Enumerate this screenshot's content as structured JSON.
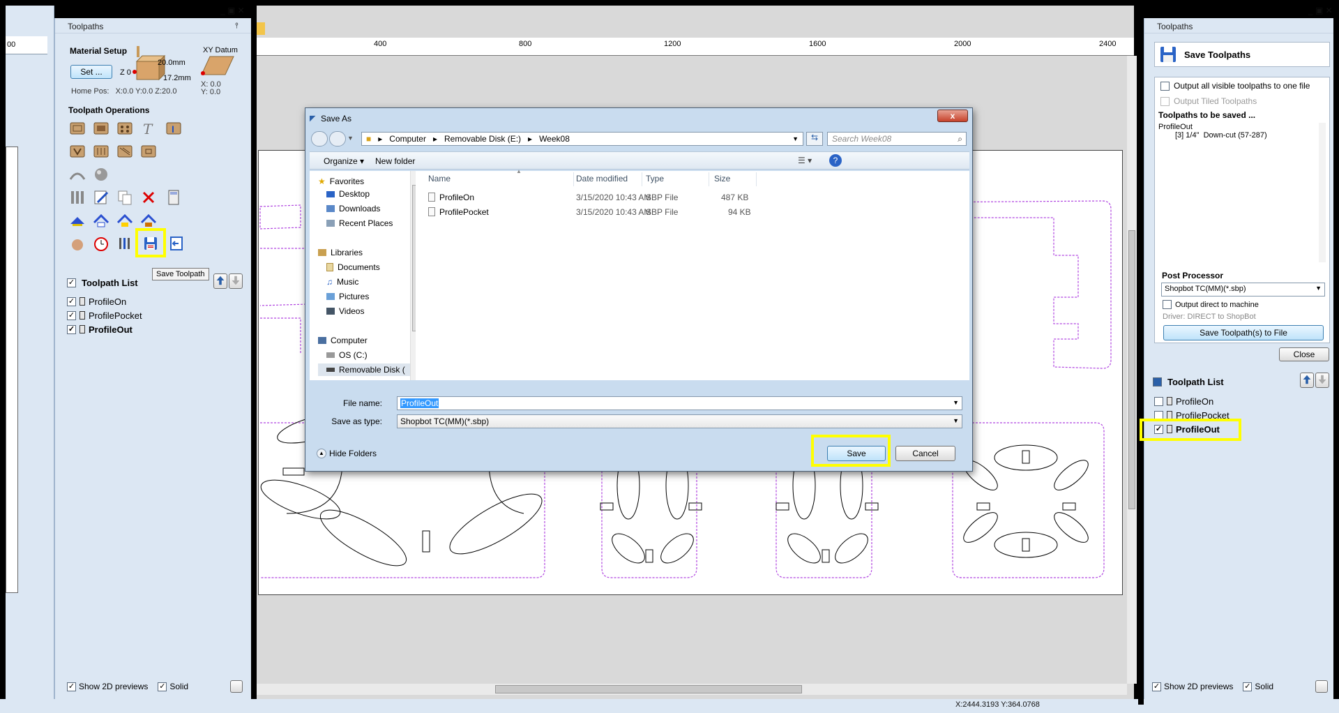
{
  "left_panel": {
    "title": "Toolpaths",
    "material_setup": {
      "heading": "Material Setup",
      "set_button": "Set ...",
      "dim_top": "20.0mm",
      "dim_bottom": "17.2mm",
      "z0": "Z 0",
      "xy_datum_label": "XY Datum",
      "home_pos": "Home Pos:   X:0.0 Y:0.0 Z:20.0",
      "datum_x": "X: 0.0",
      "datum_y": "Y: 0.0"
    },
    "operations_heading": "Toolpath Operations",
    "tooltip": "Save Toolpath",
    "toolpath_list": {
      "title": "Toolpath List",
      "items": [
        {
          "name": "ProfileOn",
          "checked": true,
          "bold": false
        },
        {
          "name": "ProfilePocket",
          "checked": true,
          "bold": false
        },
        {
          "name": "ProfileOut",
          "checked": true,
          "bold": true
        }
      ]
    },
    "footer": {
      "show_previews": "Show 2D previews",
      "solid": "Solid"
    }
  },
  "ruler": {
    "labels": [
      "400",
      "800",
      "1200",
      "1600",
      "2000",
      "2400"
    ],
    "left_label": "00"
  },
  "coordinates": "X:2444.3193 Y:364.0768",
  "dialog": {
    "title": "Save As",
    "close": "x",
    "breadcrumb": [
      "Computer",
      "Removable Disk (E:)",
      "Week08"
    ],
    "search_placeholder": "Search Week08",
    "organize": "Organize",
    "new_folder": "New folder",
    "nav": {
      "favorites": "Favorites",
      "desktop": "Desktop",
      "downloads": "Downloads",
      "recent": "Recent Places",
      "libraries": "Libraries",
      "documents": "Documents",
      "music": "Music",
      "pictures": "Pictures",
      "videos": "Videos",
      "computer": "Computer",
      "os": "OS (C:)",
      "removable": "Removable Disk ("
    },
    "columns": {
      "name": "Name",
      "date": "Date modified",
      "type": "Type",
      "size": "Size"
    },
    "files": [
      {
        "name": "ProfileOn",
        "date": "3/15/2020 10:43 AM",
        "type": "SBP File",
        "size": "487 KB"
      },
      {
        "name": "ProfilePocket",
        "date": "3/15/2020 10:43 AM",
        "type": "SBP File",
        "size": "94 KB"
      }
    ],
    "filename_label": "File name:",
    "filename_value": "ProfileOut",
    "savetype_label": "Save as type:",
    "savetype_value": "Shopbot TC(MM)(*.sbp)",
    "hide_folders": "Hide Folders",
    "save": "Save",
    "cancel": "Cancel"
  },
  "right_panel": {
    "title": "Toolpaths",
    "save_title": "Save Toolpaths",
    "output_all": "Output all visible toolpaths to one file",
    "output_tiled": "Output Tiled Toolpaths",
    "to_be_saved_heading": "Toolpaths to be saved ...",
    "to_be_saved": [
      "ProfileOut",
      "[3] 1/4\"  Down-cut (57-287)"
    ],
    "post_processor_heading": "Post Processor",
    "post_processor_value": "Shopbot TC(MM)(*.sbp)",
    "output_direct": "Output direct to machine",
    "driver": "Driver: DIRECT to ShopBot",
    "save_file_button": "Save Toolpath(s) to File",
    "close_button": "Close",
    "toolpath_list": {
      "title": "Toolpath List",
      "items": [
        {
          "name": "ProfileOn",
          "checked": false
        },
        {
          "name": "ProfilePocket",
          "checked": false
        },
        {
          "name": "ProfileOut",
          "checked": true
        }
      ]
    },
    "footer": {
      "show_previews": "Show 2D previews",
      "solid": "Solid"
    }
  },
  "colors": {
    "panel": "#dce7f3",
    "highlight": "#ffff00",
    "accent": "#3399ff",
    "toolpath_purple": "#b044e0"
  }
}
